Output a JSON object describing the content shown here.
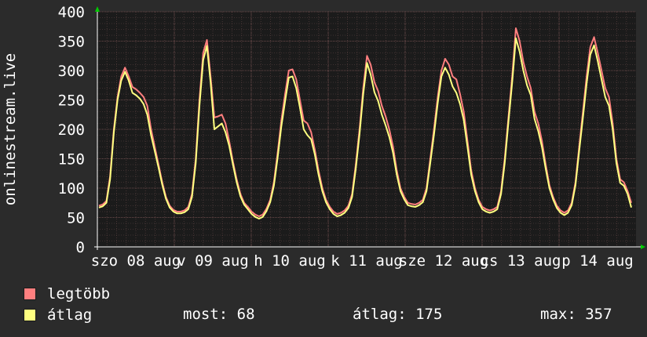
{
  "chart_data": {
    "type": "line",
    "ylabel": "onlinestream.live",
    "ylim": [
      0,
      400
    ],
    "yticks": [
      0,
      50,
      100,
      150,
      200,
      250,
      300,
      350,
      400
    ],
    "xticks": [
      "szo 08 aug",
      "v 09 aug",
      "h 10 aug",
      "k 11 aug",
      "sze 12 aug",
      "cs 13 aug",
      "p 14 aug"
    ],
    "grid": true,
    "colors": {
      "background": "#2b2b2b",
      "plot_bg": "#1b1b1b",
      "grid": "#6a4a4a",
      "axis": "#ffffff",
      "arrow": "#00cc00",
      "series_max": "#ff7f7f",
      "series_avg": "#ffff80"
    },
    "series": [
      {
        "name": "legtöbb",
        "color": "#ff7f7f",
        "values": [
          70,
          72,
          78,
          120,
          200,
          255,
          290,
          305,
          290,
          272,
          268,
          262,
          255,
          240,
          200,
          170,
          140,
          110,
          85,
          70,
          63,
          60,
          60,
          62,
          68,
          90,
          150,
          250,
          330,
          352,
          290,
          220,
          222,
          225,
          210,
          180,
          145,
          115,
          90,
          75,
          68,
          60,
          55,
          52,
          55,
          65,
          80,
          110,
          160,
          215,
          260,
          300,
          302,
          285,
          250,
          215,
          210,
          195,
          165,
          130,
          100,
          80,
          68,
          60,
          56,
          58,
          62,
          70,
          90,
          140,
          200,
          270,
          325,
          310,
          280,
          265,
          240,
          222,
          200,
          170,
          130,
          100,
          85,
          75,
          73,
          72,
          75,
          80,
          100,
          150,
          200,
          255,
          300,
          320,
          310,
          290,
          285,
          260,
          230,
          180,
          130,
          100,
          80,
          68,
          64,
          62,
          64,
          68,
          95,
          150,
          220,
          290,
          372,
          350,
          315,
          290,
          270,
          230,
          210,
          180,
          140,
          105,
          85,
          70,
          62,
          58,
          62,
          75,
          110,
          170,
          230,
          290,
          340,
          357,
          330,
          300,
          270,
          255,
          210,
          150,
          115,
          110,
          95,
          75
        ]
      },
      {
        "name": "átlag",
        "color": "#ffff80",
        "values": [
          67,
          69,
          75,
          115,
          195,
          250,
          283,
          298,
          283,
          262,
          258,
          252,
          243,
          225,
          190,
          163,
          135,
          106,
          82,
          67,
          60,
          57,
          57,
          59,
          64,
          85,
          143,
          240,
          318,
          342,
          280,
          200,
          205,
          210,
          195,
          172,
          140,
          110,
          86,
          72,
          64,
          56,
          51,
          48,
          51,
          61,
          76,
          104,
          152,
          205,
          248,
          288,
          290,
          270,
          237,
          200,
          190,
          183,
          157,
          123,
          95,
          76,
          64,
          56,
          52,
          54,
          58,
          66,
          85,
          133,
          192,
          260,
          313,
          293,
          263,
          248,
          225,
          207,
          187,
          160,
          123,
          95,
          81,
          71,
          69,
          68,
          71,
          76,
          95,
          143,
          191,
          245,
          290,
          305,
          293,
          273,
          262,
          243,
          216,
          170,
          123,
          95,
          76,
          64,
          60,
          58,
          60,
          64,
          90,
          143,
          212,
          280,
          355,
          332,
          300,
          275,
          258,
          218,
          197,
          170,
          133,
          100,
          81,
          66,
          58,
          54,
          58,
          71,
          105,
          163,
          220,
          278,
          327,
          343,
          316,
          285,
          255,
          240,
          200,
          143,
          109,
          104,
          90,
          67
        ]
      }
    ],
    "legend": [
      {
        "label": "legtöbb",
        "color": "#ff7f7f"
      },
      {
        "label": "átlag",
        "color": "#ffff80"
      }
    ],
    "stats": {
      "now": "most: 68",
      "avg": "átlag: 175",
      "max": "max: 357"
    }
  }
}
